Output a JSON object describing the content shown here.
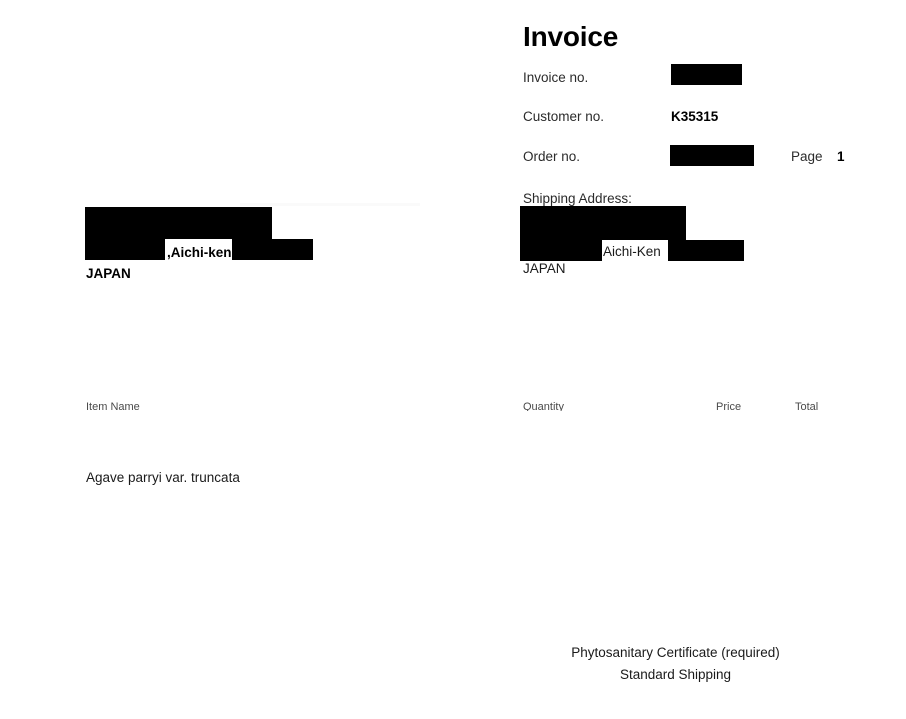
{
  "document": {
    "title": "Invoice"
  },
  "meta": {
    "invoice_no_label": "Invoice no.",
    "invoice_no_value": "",
    "customer_no_label": "Customer no.",
    "customer_no_value": "K35315",
    "order_no_label": "Order no.",
    "order_no_value": "",
    "page_label": "Page",
    "page_value": "1"
  },
  "billing_address": {
    "line_region": ",Aichi-ken",
    "country": "JAPAN"
  },
  "shipping_address": {
    "label": "Shipping Address:",
    "line_region": "Aichi-Ken",
    "country": "JAPAN"
  },
  "table": {
    "headers": {
      "item_name": "Item Name",
      "quantity": "Quantity",
      "price": "Price",
      "total": "Total"
    },
    "rows": [
      {
        "item_name": "Agave parryi var. truncata",
        "quantity": "",
        "price": "",
        "total": ""
      }
    ]
  },
  "footer": {
    "line1": "Phytosanitary Certificate (required)",
    "line2": "Standard Shipping"
  },
  "colors": {
    "redaction": "#000000",
    "page_background": "#ffffff",
    "body_text": "#1a1a1a",
    "header_text": "#4a4a4a"
  }
}
